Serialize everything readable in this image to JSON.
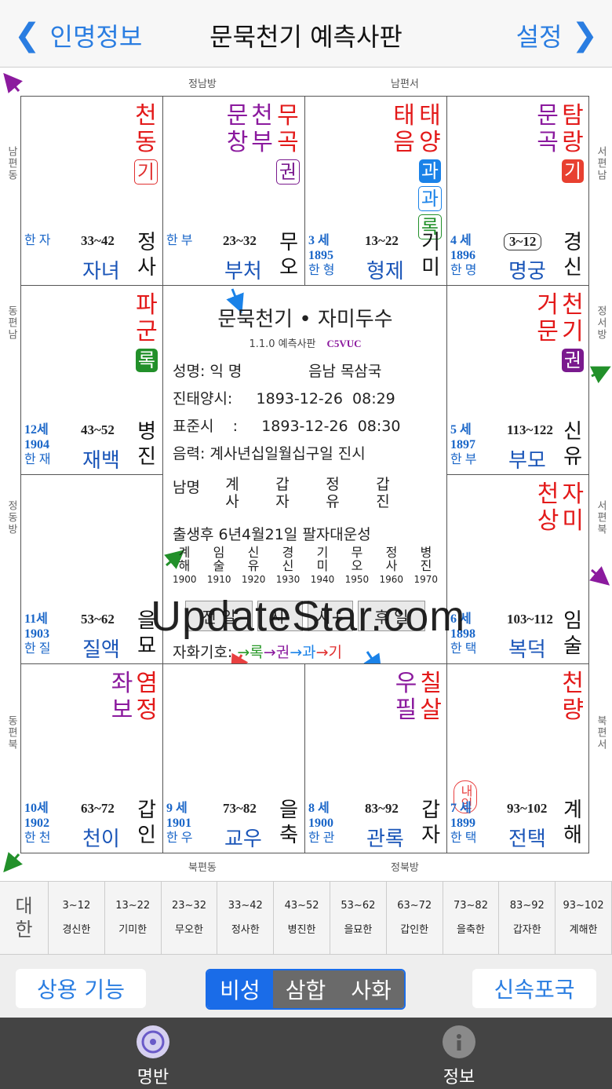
{
  "nav": {
    "back_label": "인명정보",
    "title": "문묵천기 예측사판",
    "settings_label": "설정"
  },
  "directions": {
    "top_left": "정남방",
    "top_right": "남편서",
    "bottom_left": "북편동",
    "bottom_right": "정북방",
    "left_1": "남편동",
    "left_2": "동편남",
    "left_3": "정동방",
    "left_4": "동편북",
    "right_1": "서편남",
    "right_2": "정서방",
    "right_3": "서편북",
    "right_4": "북편서"
  },
  "palaces": [
    {
      "id": "sa",
      "star_cols": [
        [
          "천",
          "동"
        ]
      ],
      "badges": [
        {
          "t": "기",
          "s": "b-red-out"
        }
      ],
      "age": "",
      "year": "",
      "name": "한 자",
      "range": "33~42",
      "palace": "자녀",
      "gz": [
        "정",
        "사"
      ]
    },
    {
      "id": "o",
      "star_cols": [
        [
          "무",
          "곡"
        ],
        [
          "천",
          "부"
        ],
        [
          "문",
          "창"
        ]
      ],
      "badges": [
        {
          "t": "권",
          "s": "b-purple-out"
        }
      ],
      "age": "",
      "year": "",
      "name": "한 부",
      "range": "23~32",
      "palace": "부처",
      "gz": [
        "무",
        "오"
      ]
    },
    {
      "id": "mi",
      "star_cols": [
        [
          "태",
          "양"
        ],
        [
          "태",
          "음"
        ]
      ],
      "badges": [
        {
          "t": "과",
          "s": "b-blue"
        },
        {
          "t": "과",
          "s": "b-blue-out"
        },
        {
          "t": "록",
          "s": "b-green-out"
        }
      ],
      "age": "3 세",
      "year": "1895",
      "name": "한 형",
      "range": "13~22",
      "palace": "형제",
      "gz": [
        "기",
        "미"
      ]
    },
    {
      "id": "sin",
      "star_cols": [
        [
          "탐",
          "랑"
        ],
        [
          "문",
          "곡"
        ]
      ],
      "badges": [
        {
          "t": "기",
          "s": "b-red"
        }
      ],
      "age": "4 세",
      "year": "1896",
      "name": "한 명",
      "range": "3~12",
      "palace": "명궁",
      "gz": [
        "경",
        "신"
      ]
    },
    {
      "id": "jin",
      "star_cols": [
        [
          "파",
          "군"
        ]
      ],
      "badges": [
        {
          "t": "록",
          "s": "b-green"
        }
      ],
      "age": "12세",
      "year": "1904",
      "name": "한 재",
      "range": "43~52",
      "palace": "재백",
      "gz": [
        "병",
        "진"
      ]
    },
    {
      "id": "yu",
      "star_cols": [
        [
          "천",
          "기"
        ],
        [
          "거",
          "문"
        ]
      ],
      "badges": [
        {
          "t": "권",
          "s": "b-purple"
        }
      ],
      "age": "5 세",
      "year": "1897",
      "name": "한 부",
      "range": "113~122",
      "palace": "부모",
      "gz": [
        "신",
        "유"
      ]
    },
    {
      "id": "myo",
      "star_cols": [],
      "badges": [],
      "age": "11세",
      "year": "1903",
      "name": "한 질",
      "range": "53~62",
      "palace": "질액",
      "gz": [
        "을",
        "묘"
      ]
    },
    {
      "id": "sul",
      "star_cols": [
        [
          "자",
          "미"
        ],
        [
          "천",
          "상"
        ]
      ],
      "badges": [],
      "age": "6 세",
      "year": "1898",
      "name": "한 택",
      "range": "103~112",
      "palace": "복덕",
      "gz": [
        "임",
        "술"
      ]
    },
    {
      "id": "in",
      "star_cols": [
        [
          "염",
          "정"
        ],
        [
          "좌",
          "보"
        ]
      ],
      "badges": [],
      "age": "10세",
      "year": "1902",
      "name": "한 천",
      "range": "63~72",
      "palace": "천이",
      "gz": [
        "갑",
        "인"
      ]
    },
    {
      "id": "chuk",
      "star_cols": [],
      "badges": [],
      "age": "9 세",
      "year": "1901",
      "name": "한 우",
      "range": "73~82",
      "palace": "교우",
      "gz": [
        "을",
        "축"
      ]
    },
    {
      "id": "ja",
      "star_cols": [
        [
          "칠",
          "살"
        ],
        [
          "우",
          "필"
        ]
      ],
      "badges": [],
      "age": "8 세",
      "year": "1900",
      "name": "한 관",
      "range": "83~92",
      "palace": "관록",
      "gz": [
        "갑",
        "자"
      ]
    },
    {
      "id": "hae",
      "star_cols": [
        [
          "천",
          "량"
        ]
      ],
      "badges": [],
      "age": "7 세",
      "year": "1899",
      "name": "한 택",
      "range": "93~102",
      "palace": "전택",
      "gz": [
        "계",
        "해"
      ],
      "neiin": "내인"
    }
  ],
  "center": {
    "title": "문묵천기 • 자미두수",
    "version": "1.1.0 예측사판",
    "code": "C5VUC",
    "name_row": "성명: 익 명              음남 목삼국",
    "true_time": "진태양시:     1893-12-26  08:29",
    "std_time": "표준시    :     1893-12-26  08:30",
    "lunar": "음력: 계사년십일월십구일 진시",
    "pillar_label": "남명",
    "pillars": [
      [
        "계",
        "사"
      ],
      [
        "갑",
        "자"
      ],
      [
        "정",
        "유"
      ],
      [
        "갑",
        "진"
      ]
    ],
    "dayun_line": "출생후 6년4월21일 팔자대운성",
    "dayun_gz": [
      [
        "계",
        "해"
      ],
      [
        "임",
        "술"
      ],
      [
        "신",
        "유"
      ],
      [
        "경",
        "신"
      ],
      [
        "기",
        "미"
      ],
      [
        "무",
        "오"
      ],
      [
        "정",
        "사"
      ],
      [
        "병",
        "진"
      ]
    ],
    "dayun_years": [
      "1900",
      "1910",
      "1920",
      "1930",
      "1940",
      "1950",
      "1960",
      "1970"
    ],
    "buttons": [
      "전 일",
      "시-",
      "시+",
      "후 일"
    ],
    "sihwa_label": "자화기호: ",
    "sihwa": [
      "→록",
      "→권",
      "→과",
      "→기"
    ]
  },
  "watermark": "UpdateStar.com",
  "dahan": {
    "label": [
      "대",
      "한"
    ],
    "items": [
      {
        "range": "3~12",
        "gz": "경신한"
      },
      {
        "range": "13~22",
        "gz": "기미한"
      },
      {
        "range": "23~32",
        "gz": "무오한"
      },
      {
        "range": "33~42",
        "gz": "정사한"
      },
      {
        "range": "43~52",
        "gz": "병진한"
      },
      {
        "range": "53~62",
        "gz": "을묘한"
      },
      {
        "range": "63~72",
        "gz": "갑인한"
      },
      {
        "range": "73~82",
        "gz": "을축한"
      },
      {
        "range": "83~92",
        "gz": "갑자한"
      },
      {
        "range": "93~102",
        "gz": "계해한"
      }
    ]
  },
  "toolbar": {
    "common_label": "상용 기능",
    "segments": [
      "비성",
      "삼합",
      "사화"
    ],
    "active_segment": "비성",
    "quick_label": "신속포국"
  },
  "tabbar": {
    "tab1": "명반",
    "tab2": "정보"
  }
}
